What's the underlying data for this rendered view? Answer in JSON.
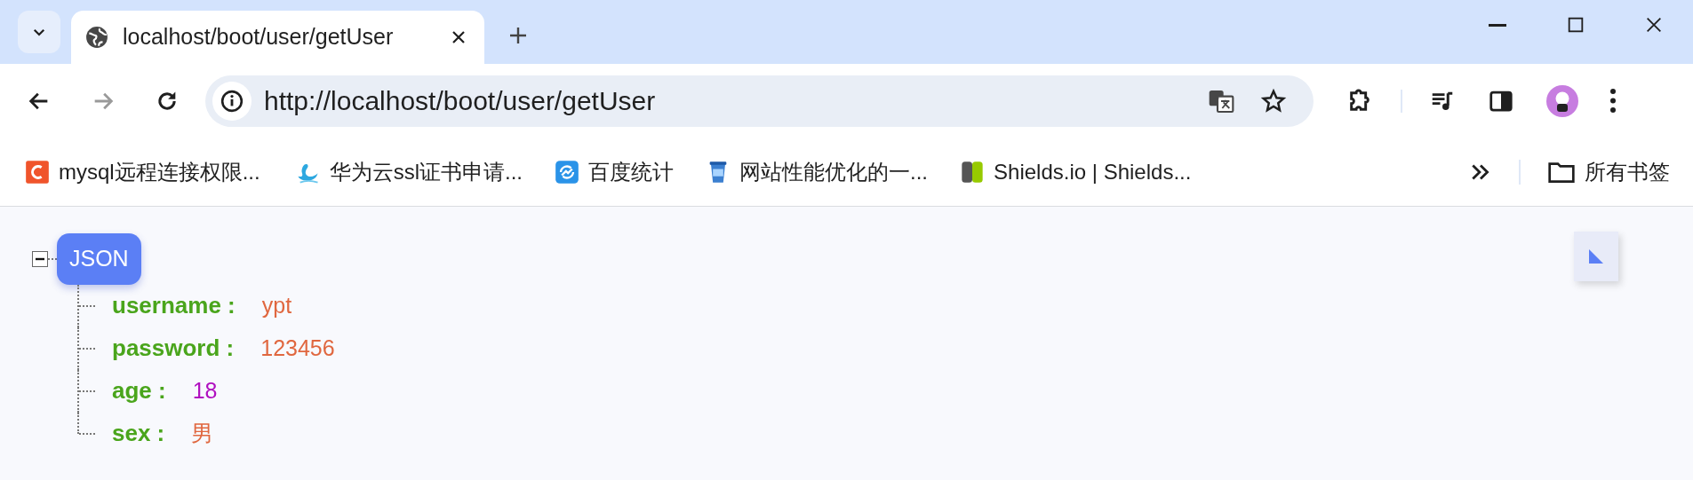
{
  "tabs": [
    {
      "title": "localhost/boot/user/getUser",
      "selected": true
    }
  ],
  "address_bar": {
    "url": "http://localhost/boot/user/getUser"
  },
  "bookmarks": [
    {
      "label": "mysql远程连接权限..."
    },
    {
      "label": "华为云ssl证书申请..."
    },
    {
      "label": "百度统计"
    },
    {
      "label": "网站性能优化的一..."
    },
    {
      "label": "Shields.io | Shields..."
    }
  ],
  "all_bookmarks": "所有书签",
  "json_viewer": {
    "root_label": "JSON",
    "expanded": true,
    "entries": [
      {
        "key": "username :",
        "value": "ypt",
        "kind": "string"
      },
      {
        "key": "password :",
        "value": "123456",
        "kind": "string"
      },
      {
        "key": "age :",
        "value": "18",
        "kind": "number"
      },
      {
        "key": "sex :",
        "value": "男",
        "kind": "string"
      }
    ]
  }
}
